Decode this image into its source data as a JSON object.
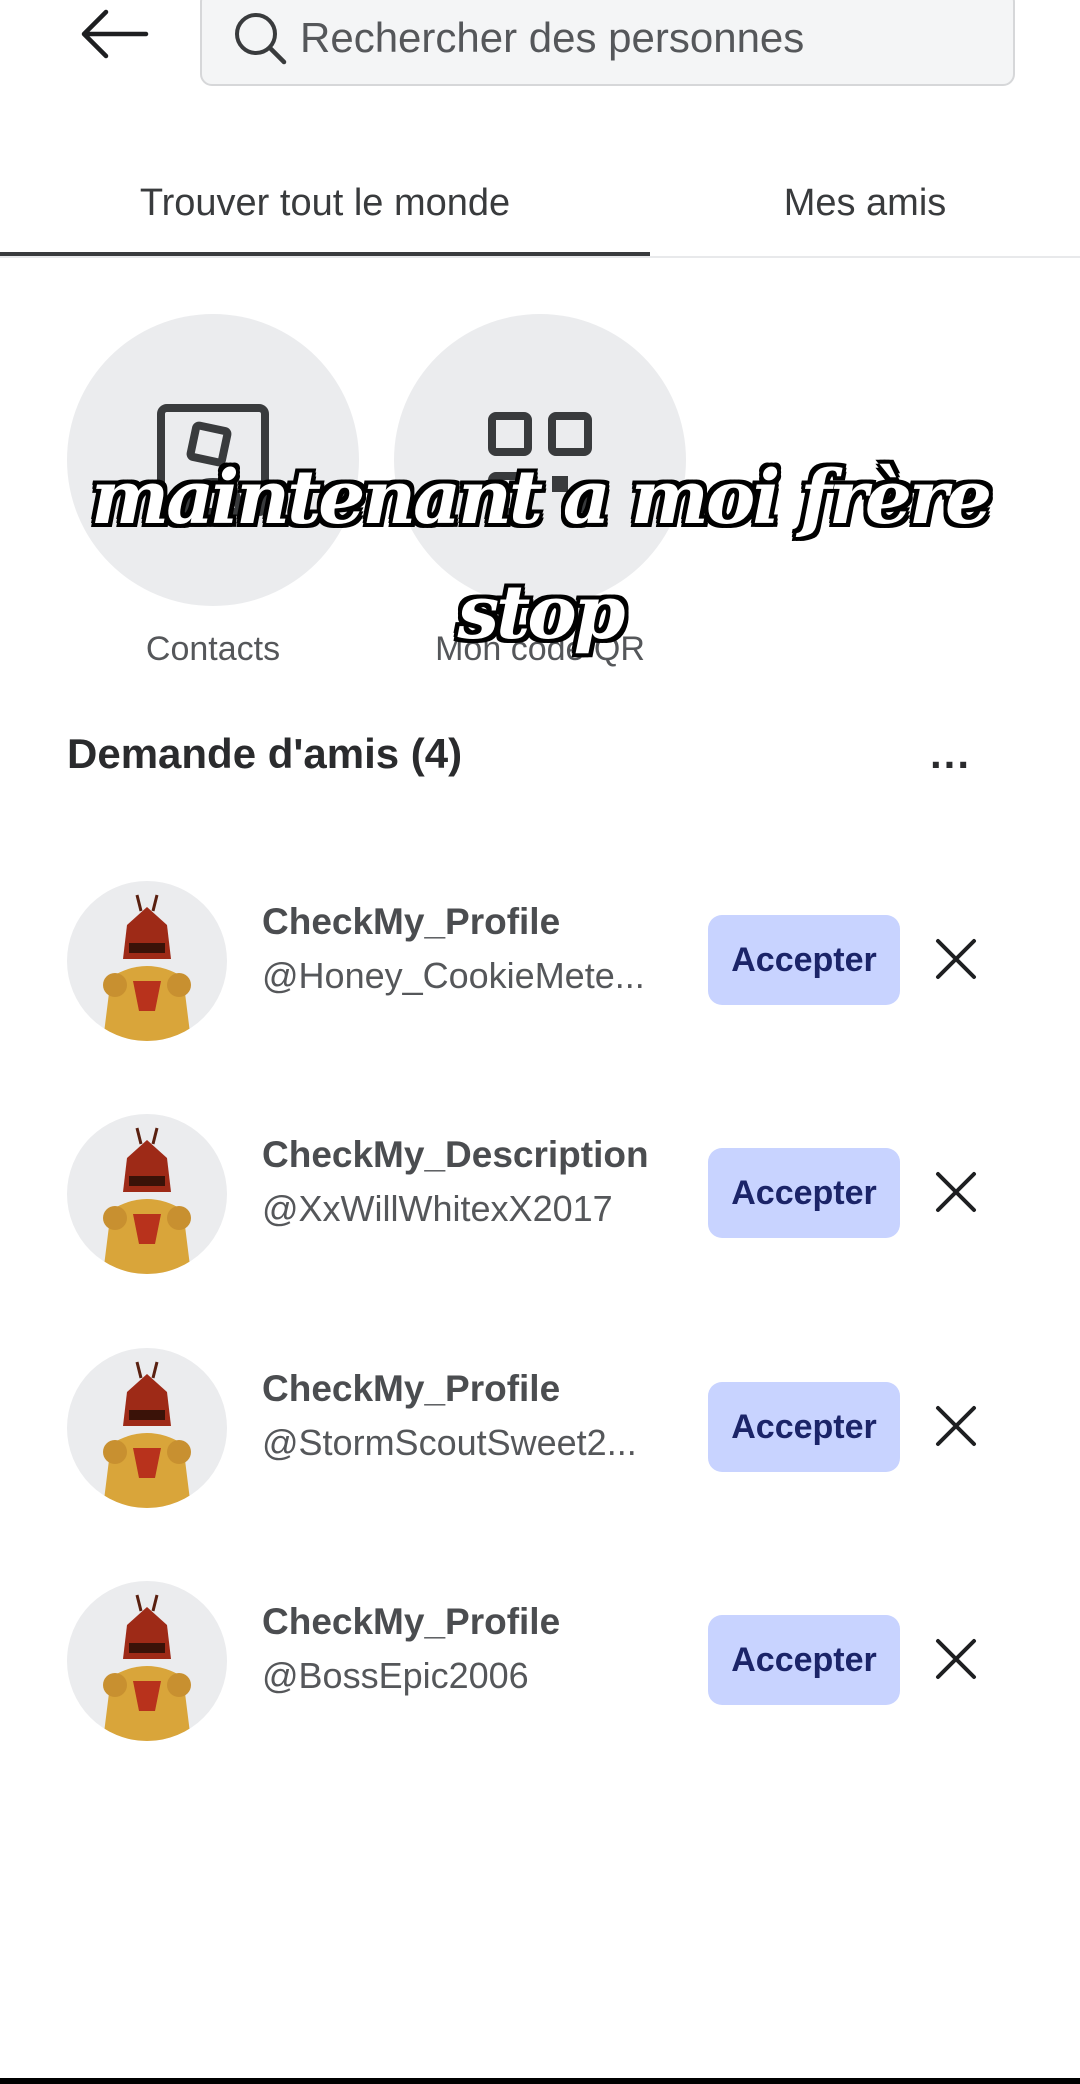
{
  "search": {
    "placeholder": "Rechercher des personnes"
  },
  "tabs": [
    {
      "label": "Trouver tout le monde",
      "active": true
    },
    {
      "label": "Mes amis",
      "active": false
    }
  ],
  "quick_actions": [
    {
      "label": "Contacts",
      "icon": "contacts-icon"
    },
    {
      "label": "Mon code QR",
      "icon": "qr-code-icon"
    }
  ],
  "overlay_caption": {
    "line1": "maintenant a moi frère",
    "line2": "stop"
  },
  "friend_requests": {
    "title": "Demande d'amis (4)",
    "more_label": "...",
    "items": [
      {
        "display_name": "CheckMy_Profile",
        "username": "@Honey_CookieMete...",
        "accept_label": "Accepter"
      },
      {
        "display_name": "CheckMy_Description",
        "username": "@XxWillWhitexX2017",
        "accept_label": "Accepter"
      },
      {
        "display_name": "CheckMy_Profile",
        "username": "@StormScoutSweet2...",
        "accept_label": "Accepter"
      },
      {
        "display_name": "CheckMy_Profile",
        "username": "@BossEpic2006",
        "accept_label": "Accepter"
      }
    ]
  },
  "colors": {
    "accept_bg": "#c8d3ff",
    "accept_text": "#1b2468",
    "tab_underline": "#393b3d"
  }
}
